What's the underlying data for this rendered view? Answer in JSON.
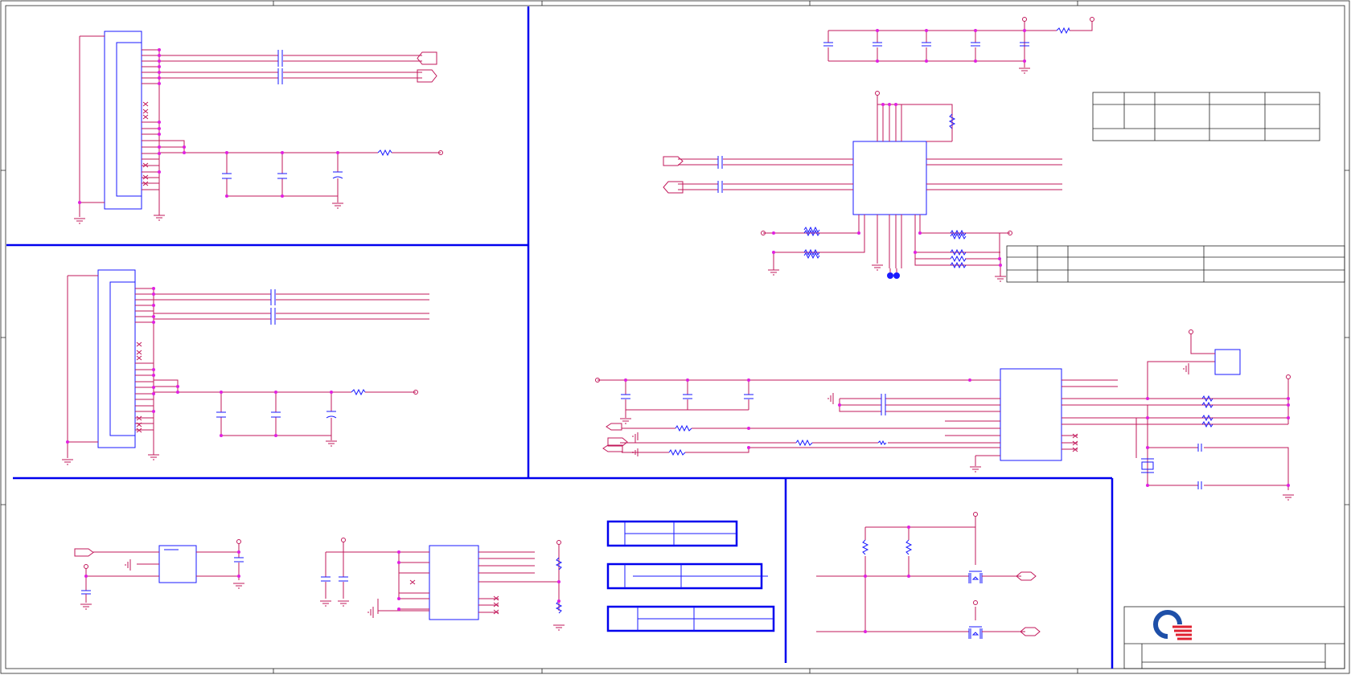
{
  "page": {
    "title": "",
    "background": "#ffffff"
  },
  "colors": {
    "wire": "#c2185b",
    "component": "#1a1aff",
    "frame": "#0000ee",
    "junction": "#e020e0",
    "logo_blue": "#1e4fa8",
    "logo_red": "#e02030"
  },
  "icons": [
    "connector-icon",
    "capacitor-icon",
    "resistor-icon",
    "ground-icon",
    "ic-icon",
    "mosfet-icon",
    "crystal-icon",
    "company-logo-icon"
  ],
  "title_block": {
    "company": "",
    "document": "",
    "sheet": ""
  }
}
